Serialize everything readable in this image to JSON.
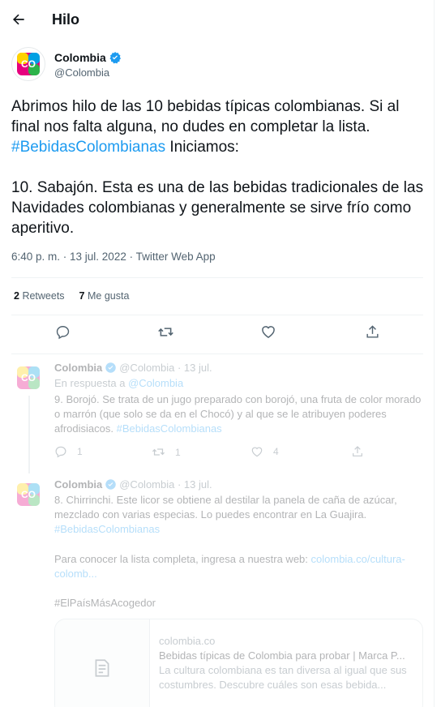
{
  "header": {
    "title": "Hilo"
  },
  "tweet": {
    "author_name": "Colombia",
    "author_handle": "@Colombia",
    "logo_text": "CO",
    "logo_subtext": "COLOMBIA",
    "text_line1": "Abrimos hilo de las 10 bebidas típicas colombianas. Si al final nos falta alguna, no dudes en completar la lista. ",
    "hashtag": "#BebidasColombianas",
    "text_line1_end": " Iniciamos:",
    "text_line2": "10. Sabajón. Esta es una de las bebidas tradicionales de las Navidades colombianas y generalmente se sirve frío como aperitivo.",
    "meta": "6:40 p. m. · 13 jul. 2022 · Twitter Web App",
    "retweets_count": "2",
    "retweets_label": "Retweets",
    "likes_count": "7",
    "likes_label": "Me gusta"
  },
  "replies": [
    {
      "author_name": "Colombia",
      "handle_date": "@Colombia · 13 jul.",
      "reply_to_prefix": "En respuesta a ",
      "reply_to_handle": "@Colombia",
      "text": "9. Borojó. Se trata de un jugo preparado con borojó, una fruta de color morado o marrón (que solo se da en el Chocó) y al que se le atribuyen poderes afrodisiacos. ",
      "hashtag": "#BebidasColombianas",
      "reply_count": "1",
      "retweet_count": "1",
      "like_count": "4"
    },
    {
      "author_name": "Colombia",
      "handle_date": "@Colombia · 13 jul.",
      "text": "8. Chirrinchi. Este licor se obtiene al destilar la panela de caña de azúcar, mezclado con varias especias. Lo puedes encontrar en La Guajira.",
      "hashtag": "#BebidasColombianas",
      "extra_text": "Para conocer la lista completa, ingresa a nuestra web: ",
      "extra_link": "colombia.co/cultura-colomb...",
      "hashtag2": "#ElPaísMásAcogedor",
      "card": {
        "domain": "colombia.co",
        "title": "Bebidas típicas de Colombia para probar | Marca P...",
        "description": "La cultura colombiana es tan diversa al igual que sus costumbres. Descubre cuáles son esas bebida..."
      }
    }
  ],
  "colors": {
    "accent": "#1d9bf0",
    "text": "#0f1419",
    "muted": "#536471"
  },
  "icons": [
    "back-arrow-icon",
    "verified-badge-icon",
    "reply-icon",
    "retweet-icon",
    "like-icon",
    "share-icon",
    "document-icon"
  ]
}
